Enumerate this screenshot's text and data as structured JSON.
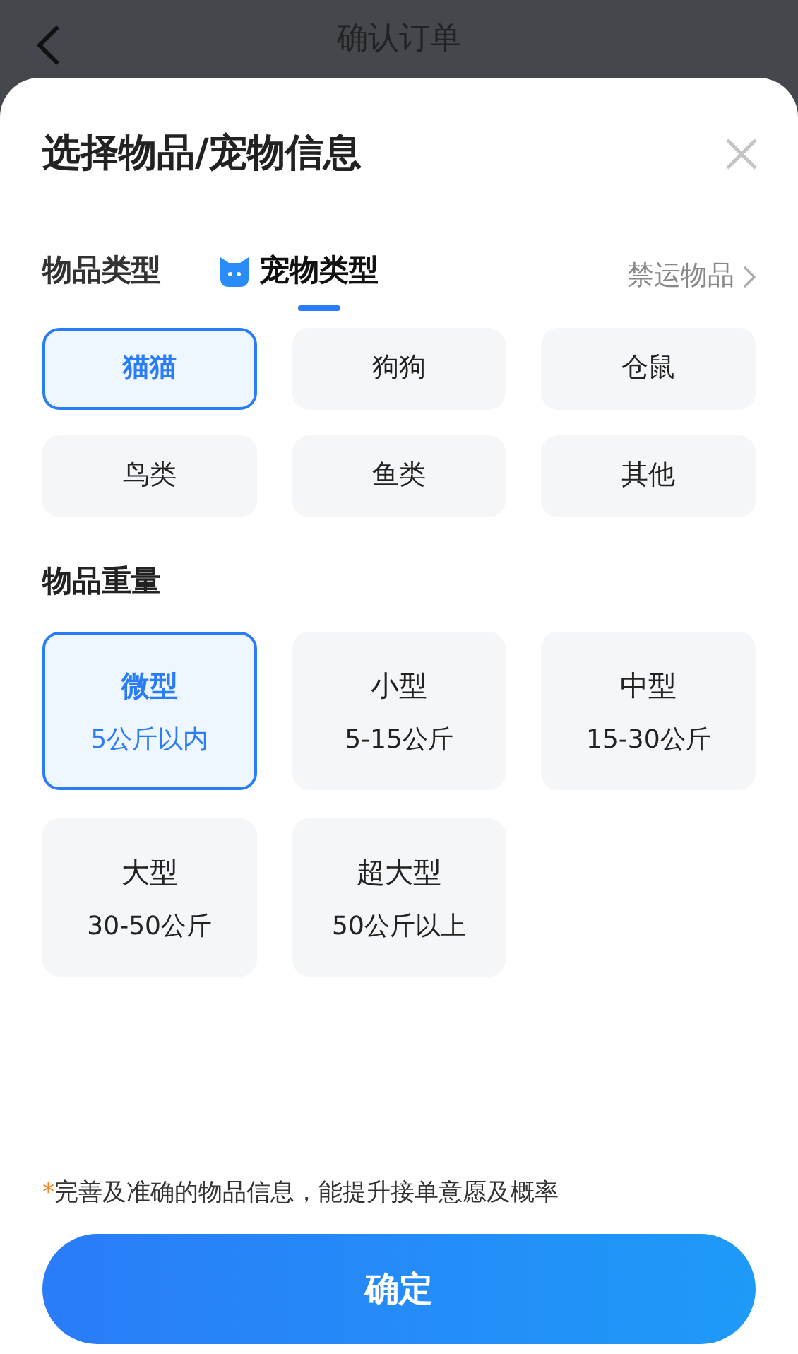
{
  "top_bar": {
    "title": "确认订单"
  },
  "sheet": {
    "title": "选择物品/宠物信息"
  },
  "tabs": [
    {
      "label": "物品类型",
      "kind": "goods",
      "selected": false
    },
    {
      "label": "宠物类型",
      "kind": "pet",
      "selected": true
    }
  ],
  "forbidden_link": "禁运物品",
  "types": [
    {
      "label": "猫猫",
      "selected": true
    },
    {
      "label": "狗狗",
      "selected": false
    },
    {
      "label": "仓鼠",
      "selected": false
    },
    {
      "label": "鸟类",
      "selected": false
    },
    {
      "label": "鱼类",
      "selected": false
    },
    {
      "label": "其他",
      "selected": false
    }
  ],
  "weight_title": "物品重量",
  "weights": [
    {
      "label": "微型",
      "range": "5公斤以内",
      "selected": true
    },
    {
      "label": "小型",
      "range": "5-15公斤",
      "selected": false
    },
    {
      "label": "中型",
      "range": "15-30公斤",
      "selected": false
    },
    {
      "label": "大型",
      "range": "30-50公斤",
      "selected": false
    },
    {
      "label": "超大型",
      "range": "50公斤以上",
      "selected": false
    }
  ],
  "note": {
    "mark": "*",
    "text": "完善及准确的物品信息，能提升接单意愿及概率"
  },
  "confirm_button": "确定"
}
